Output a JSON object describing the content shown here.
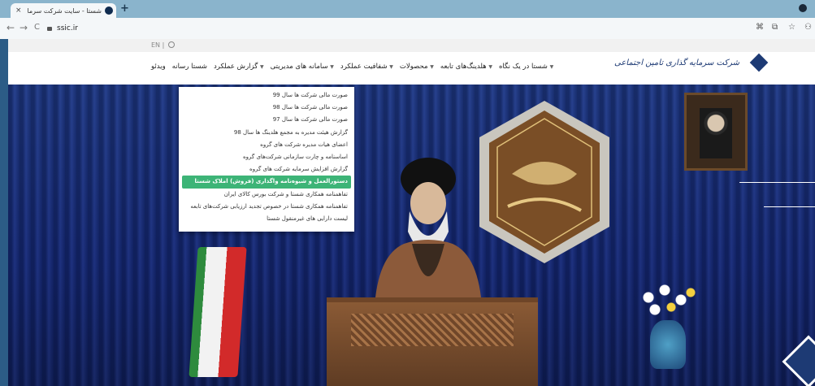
{
  "browser": {
    "tab_title": "شستا - سایت شرکت سرمایه گذاری ...",
    "tab_close": "×",
    "new_tab": "+",
    "url": "ssic.ir",
    "back": "←",
    "forward": "→",
    "reload": "C",
    "toolbar_icons": [
      "⌘",
      "⧉",
      "☆",
      "⚇"
    ]
  },
  "site": {
    "lang_toggle": "EN |",
    "logo_text": "شرکت سرمایه گذاری تامین اجتماعی",
    "menu": [
      {
        "label": "شستا در یک نگاه",
        "caret": true
      },
      {
        "label": "هلدینگ‌های تابعه",
        "caret": true
      },
      {
        "label": "محصولات",
        "caret": true
      },
      {
        "label": "شفافیت عملکرد",
        "caret": true
      },
      {
        "label": "سامانه های مدیریتی",
        "caret": true
      },
      {
        "label": "گزارش عملکرد",
        "caret": true
      },
      {
        "label": "شستا رسانه",
        "caret": false
      },
      {
        "label": "ویدئو",
        "caret": false
      }
    ],
    "dropdown": [
      {
        "label": "صورت مالی شرکت ها سال 99",
        "active": false
      },
      {
        "label": "صورت مالی شرکت ها سال 98",
        "active": false
      },
      {
        "label": "صورت مالی شرکت ها سال 97",
        "active": false
      },
      {
        "label": "گزارش هیئت مدیره به مجمع هلدینگ ها سال 98",
        "active": false
      },
      {
        "label": "اعضای هیات مدیره شرکت های گروه",
        "active": false
      },
      {
        "label": "اساسنامه و چارت سازمانی شرکت‌های گروه",
        "active": false
      },
      {
        "label": "گزارش افزایش سرمایه شرکت های گروه",
        "active": false
      },
      {
        "label": "دستورالعمل و شیوه‌نامه واگذاری (فروش) املاک شستا",
        "active": true
      },
      {
        "label": "تفاهمنامه همکاری شستا و شرکت بورس کالای ایران",
        "active": false
      },
      {
        "label": "تفاهمنامه همکاری شستا در خصوص تجدید ارزیابی شرکت‌های تابعه",
        "active": false
      },
      {
        "label": "لیست دارایی های غیرمنقول شستا",
        "active": false
      }
    ],
    "colors": {
      "brand": "#1d3a74",
      "active_menu": "#3db477",
      "hero_blue": "#15297a"
    }
  }
}
